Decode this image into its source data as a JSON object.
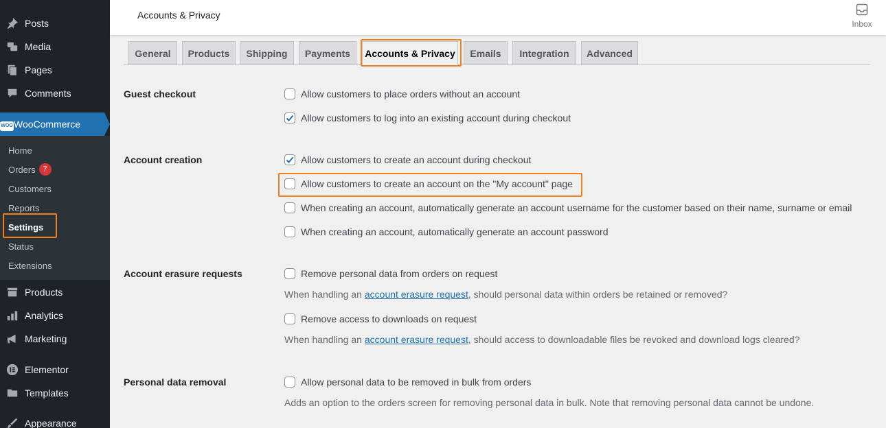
{
  "sidebar": {
    "items": [
      {
        "label": "Posts",
        "icon": "pin-icon"
      },
      {
        "label": "Media",
        "icon": "media-icon"
      },
      {
        "label": "Pages",
        "icon": "pages-icon"
      },
      {
        "label": "Comments",
        "icon": "comment-icon"
      },
      {
        "label": "WooCommerce",
        "icon": "woo-icon"
      },
      {
        "label": "Products",
        "icon": "archive-icon"
      },
      {
        "label": "Analytics",
        "icon": "bar-chart-icon"
      },
      {
        "label": "Marketing",
        "icon": "megaphone-icon"
      },
      {
        "label": "Elementor",
        "icon": "elementor-icon"
      },
      {
        "label": "Templates",
        "icon": "folder-icon"
      },
      {
        "label": "Appearance",
        "icon": "brush-icon"
      }
    ],
    "woo_icon_text": "WOO",
    "submenu": [
      {
        "label": "Home"
      },
      {
        "label": "Orders",
        "badge": "7"
      },
      {
        "label": "Customers"
      },
      {
        "label": "Reports"
      },
      {
        "label": "Settings",
        "current": true
      },
      {
        "label": "Status"
      },
      {
        "label": "Extensions"
      }
    ]
  },
  "header": {
    "title": "Accounts & Privacy",
    "inbox_label": "Inbox"
  },
  "tabs": [
    {
      "label": "General"
    },
    {
      "label": "Products"
    },
    {
      "label": "Shipping"
    },
    {
      "label": "Payments"
    },
    {
      "label": "Accounts & Privacy",
      "active": true
    },
    {
      "label": "Emails"
    },
    {
      "label": "Integration"
    },
    {
      "label": "Advanced"
    }
  ],
  "sections": {
    "guest_checkout": {
      "label": "Guest checkout",
      "options": [
        {
          "label": "Allow customers to place orders without an account",
          "checked": false
        },
        {
          "label": "Allow customers to log into an existing account during checkout",
          "checked": true
        }
      ]
    },
    "account_creation": {
      "label": "Account creation",
      "options": [
        {
          "label": "Allow customers to create an account during checkout",
          "checked": true
        },
        {
          "label": "Allow customers to create an account on the \"My account\" page",
          "checked": false
        },
        {
          "label": "When creating an account, automatically generate an account username for the customer based on their name, surname or email",
          "checked": false
        },
        {
          "label": "When creating an account, automatically generate an account password",
          "checked": false
        }
      ]
    },
    "erasure": {
      "label": "Account erasure requests",
      "options": [
        {
          "label": "Remove personal data from orders on request",
          "checked": false
        },
        {
          "label": "Remove access to downloads on request",
          "checked": false
        }
      ],
      "desc1_before": "When handling an",
      "desc1_link": "account erasure request",
      "desc1_after": ", should personal data within orders be retained or removed?",
      "desc2_before": "When handling an",
      "desc2_link": "account erasure request",
      "desc2_after": ", should access to downloadable files be revoked and download logs cleared?"
    },
    "removal": {
      "label": "Personal data removal",
      "options": [
        {
          "label": "Allow personal data to be removed in bulk from orders",
          "checked": false
        }
      ],
      "desc": "Adds an option to the orders screen for removing personal data in bulk. Note that removing personal data cannot be undone."
    }
  },
  "colors": {
    "sidebar_bg": "#1d2327",
    "submenu_bg": "#2c3338",
    "accent": "#2271b1",
    "highlight": "#f0821e",
    "badge": "#d63638"
  }
}
